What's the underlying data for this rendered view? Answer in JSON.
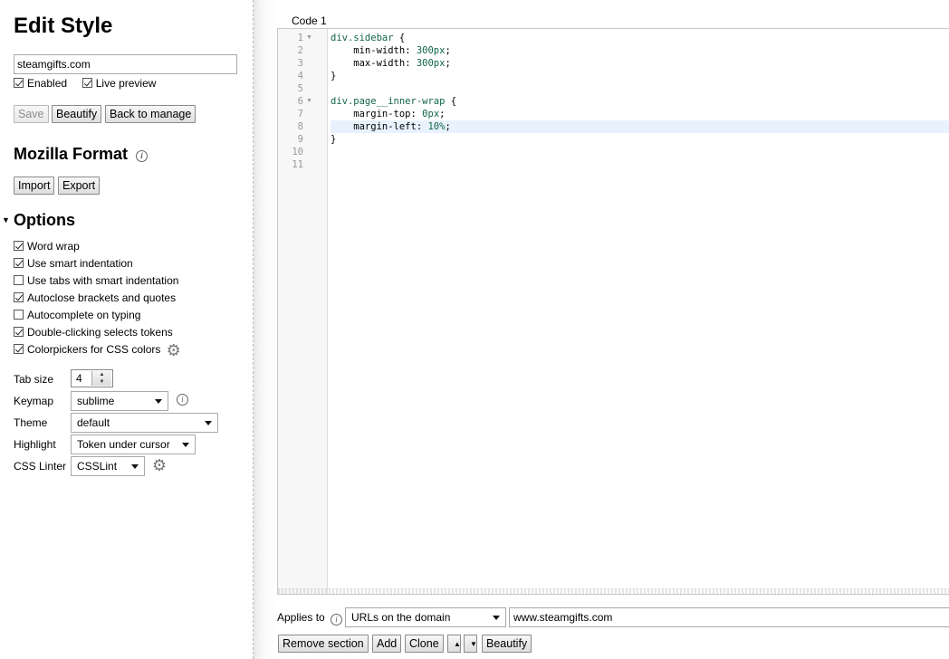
{
  "sidebar": {
    "title": "Edit Style",
    "style_name": "steamgifts.com",
    "enabled_label": "Enabled",
    "live_preview_label": "Live preview",
    "buttons": {
      "save": "Save",
      "beautify": "Beautify",
      "back": "Back to manage"
    },
    "mozilla_format": {
      "title": "Mozilla Format",
      "import": "Import",
      "export": "Export"
    },
    "options": {
      "title": "Options",
      "checkboxes": [
        {
          "label": "Word wrap",
          "checked": true
        },
        {
          "label": "Use smart indentation",
          "checked": true
        },
        {
          "label": "Use tabs with smart indentation",
          "checked": false
        },
        {
          "label": "Autoclose brackets and quotes",
          "checked": true
        },
        {
          "label": "Autocomplete on typing",
          "checked": false
        },
        {
          "label": "Double-clicking selects tokens",
          "checked": true
        },
        {
          "label": "Colorpickers for CSS colors",
          "checked": true
        }
      ],
      "tab_size_label": "Tab size",
      "tab_size_value": "4",
      "keymap_label": "Keymap",
      "keymap_value": "sublime",
      "theme_label": "Theme",
      "theme_value": "default",
      "highlight_label": "Highlight",
      "highlight_value": "Token under cursor",
      "linter_label": "CSS Linter",
      "linter_value": "CSSLint"
    }
  },
  "editor": {
    "section_title": "Code 1",
    "line_numbers": [
      "1",
      "2",
      "3",
      "4",
      "5",
      "6",
      "7",
      "8",
      "9",
      "10",
      "11"
    ],
    "fold_markers": [
      "▼",
      "",
      "",
      "",
      "",
      "▼",
      "",
      "",
      "",
      "",
      ""
    ],
    "lines": [
      [
        {
          "t": "div.sidebar",
          "c": "sel"
        },
        {
          "t": " {",
          "c": "punc"
        }
      ],
      [
        {
          "t": "    min-width",
          "c": "prop"
        },
        {
          "t": ": ",
          "c": "punc"
        },
        {
          "t": "300px",
          "c": "num"
        },
        {
          "t": ";",
          "c": "punc"
        }
      ],
      [
        {
          "t": "    max-width",
          "c": "prop"
        },
        {
          "t": ": ",
          "c": "punc"
        },
        {
          "t": "300px",
          "c": "num"
        },
        {
          "t": ";",
          "c": "punc"
        }
      ],
      [
        {
          "t": "}",
          "c": "punc"
        }
      ],
      [],
      [
        {
          "t": "div.page__inner-wrap",
          "c": "sel"
        },
        {
          "t": " {",
          "c": "punc"
        }
      ],
      [
        {
          "t": "    margin-top",
          "c": "prop"
        },
        {
          "t": ": ",
          "c": "punc"
        },
        {
          "t": "0px",
          "c": "num"
        },
        {
          "t": ";",
          "c": "punc"
        }
      ],
      [
        {
          "t": "    margin-left",
          "c": "prop"
        },
        {
          "t": ": ",
          "c": "punc"
        },
        {
          "t": "10%",
          "c": "num"
        },
        {
          "t": ";",
          "c": "punc"
        }
      ],
      [
        {
          "t": "}",
          "c": "punc"
        }
      ],
      [],
      []
    ],
    "active_line": 8
  },
  "applies": {
    "label": "Applies to",
    "type_value": "URLs on the domain",
    "url_value": "www.steamgifts.com",
    "buttons": {
      "remove": "Remove section",
      "add": "Add",
      "clone": "Clone",
      "up": "▲",
      "down": "▼",
      "beautify": "Beautify"
    }
  },
  "icons": {
    "info": "info-icon",
    "gear": "gear-icon",
    "triangle": "triangle-down-icon"
  }
}
